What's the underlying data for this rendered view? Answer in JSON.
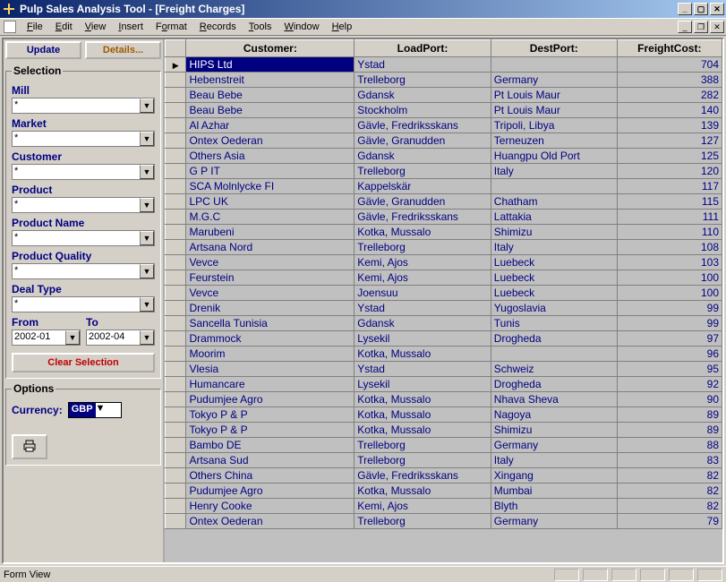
{
  "window": {
    "title": "Pulp Sales Analysis Tool - [Freight Charges]"
  },
  "menu": {
    "file": "File",
    "edit": "Edit",
    "view": "View",
    "insert": "Insert",
    "format": "Format",
    "records": "Records",
    "tools": "Tools",
    "window": "Window",
    "help": "Help"
  },
  "buttons": {
    "update": "Update",
    "details": "Details...",
    "clear": "Clear Selection"
  },
  "selection": {
    "legend": "Selection",
    "mill_label": "Mill",
    "mill_value": "*",
    "market_label": "Market",
    "market_value": "*",
    "customer_label": "Customer",
    "customer_value": "*",
    "product_label": "Product",
    "product_value": "*",
    "product_name_label": "Product Name",
    "product_name_value": "*",
    "product_quality_label": "Product Quality",
    "product_quality_value": "*",
    "deal_type_label": "Deal Type",
    "deal_type_value": "*",
    "from_label": "From",
    "to_label": "To",
    "from_value": "2002-01",
    "to_value": "2002-04"
  },
  "options": {
    "legend": "Options",
    "currency_label": "Currency:",
    "currency_value": "GBP"
  },
  "grid": {
    "headers": {
      "customer": "Customer:",
      "loadport": "LoadPort:",
      "destport": "DestPort:",
      "freightcost": "FreightCost:"
    },
    "rows": [
      {
        "customer": "HIPS Ltd",
        "loadport": "Ystad",
        "destport": "",
        "freightcost": 704,
        "selected": true
      },
      {
        "customer": "Hebenstreit",
        "loadport": "Trelleborg",
        "destport": "Germany",
        "freightcost": 388
      },
      {
        "customer": "Beau Bebe",
        "loadport": "Gdansk",
        "destport": "Pt Louis  Maur",
        "freightcost": 282
      },
      {
        "customer": "Beau Bebe",
        "loadport": "Stockholm",
        "destport": "Pt Louis  Maur",
        "freightcost": 140
      },
      {
        "customer": "Al Azhar",
        "loadport": "Gävle, Fredriksskans",
        "destport": "Tripoli,  Libya",
        "freightcost": 139
      },
      {
        "customer": "Ontex Oederan",
        "loadport": "Gävle, Granudden",
        "destport": "Terneuzen",
        "freightcost": 127
      },
      {
        "customer": "Others Asia",
        "loadport": "Gdansk",
        "destport": "Huangpu Old Port",
        "freightcost": 125
      },
      {
        "customer": "G P IT",
        "loadport": "Trelleborg",
        "destport": "Italy",
        "freightcost": 120
      },
      {
        "customer": "SCA Molnlycke FI",
        "loadport": "Kappelskär",
        "destport": "",
        "freightcost": 117
      },
      {
        "customer": "LPC UK",
        "loadport": "Gävle, Granudden",
        "destport": "Chatham",
        "freightcost": 115
      },
      {
        "customer": "M.G.C",
        "loadport": "Gävle, Fredriksskans",
        "destport": "Lattakia",
        "freightcost": 111
      },
      {
        "customer": "Marubeni",
        "loadport": "Kotka,  Mussalo",
        "destport": "Shimizu",
        "freightcost": 110
      },
      {
        "customer": "Artsana Nord",
        "loadport": "Trelleborg",
        "destport": "Italy",
        "freightcost": 108
      },
      {
        "customer": "Vevce",
        "loadport": "Kemi,  Ajos",
        "destport": "Luebeck",
        "freightcost": 103
      },
      {
        "customer": "Feurstein",
        "loadport": "Kemi,  Ajos",
        "destport": "Luebeck",
        "freightcost": 100
      },
      {
        "customer": "Vevce",
        "loadport": "Joensuu",
        "destport": "Luebeck",
        "freightcost": 100
      },
      {
        "customer": "Drenik",
        "loadport": "Ystad",
        "destport": "Yugoslavia",
        "freightcost": 99
      },
      {
        "customer": "Sancella Tunisia",
        "loadport": "Gdansk",
        "destport": "Tunis",
        "freightcost": 99
      },
      {
        "customer": "Drammock",
        "loadport": "Lysekil",
        "destport": "Drogheda",
        "freightcost": 97
      },
      {
        "customer": "Moorim",
        "loadport": "Kotka,  Mussalo",
        "destport": "",
        "freightcost": 96
      },
      {
        "customer": "Vlesia",
        "loadport": "Ystad",
        "destport": "Schweiz",
        "freightcost": 95
      },
      {
        "customer": "Humancare",
        "loadport": "Lysekil",
        "destport": "Drogheda",
        "freightcost": 92
      },
      {
        "customer": "Pudumjee Agro",
        "loadport": "Kotka,  Mussalo",
        "destport": "Nhava Sheva",
        "freightcost": 90
      },
      {
        "customer": "Tokyo P & P",
        "loadport": "Kotka,  Mussalo",
        "destport": "Nagoya",
        "freightcost": 89
      },
      {
        "customer": "Tokyo P & P",
        "loadport": "Kotka,  Mussalo",
        "destport": "Shimizu",
        "freightcost": 89
      },
      {
        "customer": "Bambo DE",
        "loadport": "Trelleborg",
        "destport": "Germany",
        "freightcost": 88
      },
      {
        "customer": "Artsana Sud",
        "loadport": "Trelleborg",
        "destport": "Italy",
        "freightcost": 83
      },
      {
        "customer": "Others China",
        "loadport": "Gävle, Fredriksskans",
        "destport": "Xingang",
        "freightcost": 82
      },
      {
        "customer": "Pudumjee Agro",
        "loadport": "Kotka,  Mussalo",
        "destport": "Mumbai",
        "freightcost": 82
      },
      {
        "customer": "Henry Cooke",
        "loadport": "Kemi,  Ajos",
        "destport": "Blyth",
        "freightcost": 82
      },
      {
        "customer": "Ontex Oederan",
        "loadport": "Trelleborg",
        "destport": "Germany",
        "freightcost": 79
      }
    ]
  },
  "statusbar": {
    "text": "Form View"
  }
}
